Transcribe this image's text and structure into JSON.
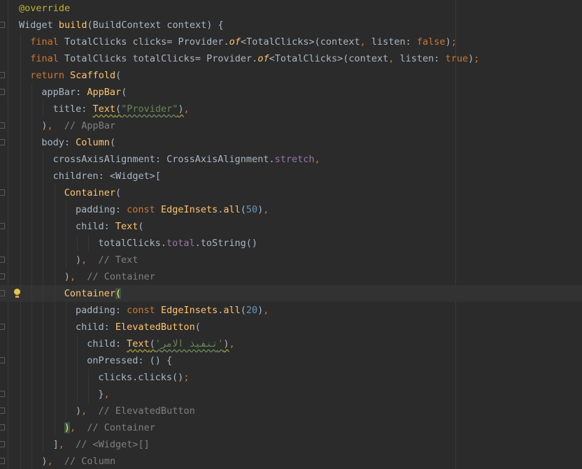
{
  "editor": {
    "lines": [
      {
        "indent": 0,
        "fold": false,
        "tokens": [
          {
            "t": "@override",
            "c": "ann"
          }
        ]
      },
      {
        "indent": 0,
        "fold": true,
        "tokens": [
          {
            "t": "Widget ",
            "c": "def"
          },
          {
            "t": "build",
            "c": "fn"
          },
          {
            "t": "(BuildContext context) {",
            "c": "def"
          }
        ]
      },
      {
        "indent": 1,
        "fold": false,
        "tokens": [
          {
            "t": "final ",
            "c": "kw"
          },
          {
            "t": "TotalClicks clicks= Provider.",
            "c": "def"
          },
          {
            "t": "of",
            "c": "ital"
          },
          {
            "t": "<TotalClicks>(context",
            "c": "def"
          },
          {
            "t": ", ",
            "c": "kw"
          },
          {
            "t": "listen: ",
            "c": "def"
          },
          {
            "t": "false",
            "c": "kw"
          },
          {
            "t": ")",
            "c": "def"
          },
          {
            "t": ";",
            "c": "kw"
          }
        ]
      },
      {
        "indent": 1,
        "fold": false,
        "tokens": [
          {
            "t": "final ",
            "c": "kw"
          },
          {
            "t": "TotalClicks totalClicks= Provider.",
            "c": "def"
          },
          {
            "t": "of",
            "c": "ital"
          },
          {
            "t": "<TotalClicks>(context",
            "c": "def"
          },
          {
            "t": ", ",
            "c": "kw"
          },
          {
            "t": "listen: ",
            "c": "def"
          },
          {
            "t": "true",
            "c": "kw"
          },
          {
            "t": ")",
            "c": "def"
          },
          {
            "t": ";",
            "c": "kw"
          }
        ]
      },
      {
        "indent": 1,
        "fold": true,
        "tokens": [
          {
            "t": "return ",
            "c": "kw"
          },
          {
            "t": "Scaffold",
            "c": "fn"
          },
          {
            "t": "(",
            "c": "def"
          }
        ]
      },
      {
        "indent": 2,
        "fold": true,
        "tokens": [
          {
            "t": "appBar: ",
            "c": "def"
          },
          {
            "t": "AppBar",
            "c": "fn"
          },
          {
            "t": "(",
            "c": "def"
          }
        ]
      },
      {
        "indent": 3,
        "fold": false,
        "tokens": [
          {
            "t": "title: ",
            "c": "def"
          },
          {
            "t": "Text",
            "c": "fn squig-y"
          },
          {
            "t": "(",
            "c": "def squig-y"
          },
          {
            "t": "\"Provider\"",
            "c": "str squig"
          },
          {
            "t": ")",
            "c": "def squig-y"
          },
          {
            "t": ",",
            "c": "kw"
          }
        ]
      },
      {
        "indent": 2,
        "fold": true,
        "tokens": [
          {
            "t": ")",
            "c": "def"
          },
          {
            "t": ",  ",
            "c": "kw"
          },
          {
            "t": "// AppBar",
            "c": "cmt"
          }
        ]
      },
      {
        "indent": 2,
        "fold": true,
        "tokens": [
          {
            "t": "body: ",
            "c": "def"
          },
          {
            "t": "Column",
            "c": "fn"
          },
          {
            "t": "(",
            "c": "def"
          }
        ]
      },
      {
        "indent": 3,
        "fold": false,
        "tokens": [
          {
            "t": "crossAxisAlignment: CrossAxisAlignment.",
            "c": "def"
          },
          {
            "t": "stretch",
            "c": "prop"
          },
          {
            "t": ",",
            "c": "kw"
          }
        ]
      },
      {
        "indent": 3,
        "fold": false,
        "tokens": [
          {
            "t": "children: <Widget>[",
            "c": "def"
          }
        ]
      },
      {
        "indent": 4,
        "fold": true,
        "tokens": [
          {
            "t": "Container",
            "c": "fn"
          },
          {
            "t": "(",
            "c": "def"
          }
        ]
      },
      {
        "indent": 5,
        "fold": false,
        "tokens": [
          {
            "t": "padding: ",
            "c": "def"
          },
          {
            "t": "const ",
            "c": "kw"
          },
          {
            "t": "EdgeInsets",
            "c": "fn"
          },
          {
            "t": ".",
            "c": "def"
          },
          {
            "t": "all",
            "c": "fn"
          },
          {
            "t": "(",
            "c": "def"
          },
          {
            "t": "50",
            "c": "num"
          },
          {
            "t": ")",
            "c": "def"
          },
          {
            "t": ",",
            "c": "kw"
          }
        ]
      },
      {
        "indent": 5,
        "fold": true,
        "tokens": [
          {
            "t": "child: ",
            "c": "def"
          },
          {
            "t": "Text",
            "c": "fn"
          },
          {
            "t": "(",
            "c": "def"
          }
        ]
      },
      {
        "indent": 7,
        "fold": false,
        "tokens": [
          {
            "t": "totalClicks.",
            "c": "def"
          },
          {
            "t": "total",
            "c": "prop"
          },
          {
            "t": ".toString()",
            "c": "def"
          }
        ]
      },
      {
        "indent": 5,
        "fold": true,
        "tokens": [
          {
            "t": ")",
            "c": "def"
          },
          {
            "t": ",  ",
            "c": "kw"
          },
          {
            "t": "// Text",
            "c": "cmt"
          }
        ]
      },
      {
        "indent": 4,
        "fold": true,
        "tokens": [
          {
            "t": ")",
            "c": "def"
          },
          {
            "t": ",  ",
            "c": "kw"
          },
          {
            "t": "// Container",
            "c": "cmt"
          }
        ]
      },
      {
        "indent": 4,
        "fold": true,
        "current": true,
        "bulb": true,
        "tokens": [
          {
            "t": "Container",
            "c": "fn"
          },
          {
            "t": "(",
            "c": "bracket-hl"
          }
        ]
      },
      {
        "indent": 5,
        "fold": false,
        "tokens": [
          {
            "t": "padding: ",
            "c": "def"
          },
          {
            "t": "const ",
            "c": "kw"
          },
          {
            "t": "EdgeInsets",
            "c": "fn"
          },
          {
            "t": ".",
            "c": "def"
          },
          {
            "t": "all",
            "c": "fn"
          },
          {
            "t": "(",
            "c": "def"
          },
          {
            "t": "20",
            "c": "num"
          },
          {
            "t": ")",
            "c": "def"
          },
          {
            "t": ",",
            "c": "kw"
          }
        ]
      },
      {
        "indent": 5,
        "fold": true,
        "tokens": [
          {
            "t": "child: ",
            "c": "def"
          },
          {
            "t": "ElevatedButton",
            "c": "fn"
          },
          {
            "t": "(",
            "c": "def"
          }
        ]
      },
      {
        "indent": 6,
        "fold": false,
        "tokens": [
          {
            "t": "child: ",
            "c": "def"
          },
          {
            "t": "Text",
            "c": "fn squig-y"
          },
          {
            "t": "(",
            "c": "def squig-y"
          },
          {
            "t": "'تنفيذ الامر'",
            "c": "str squig"
          },
          {
            "t": ")",
            "c": "def squig-y"
          },
          {
            "t": ",",
            "c": "kw"
          }
        ]
      },
      {
        "indent": 6,
        "fold": true,
        "tokens": [
          {
            "t": "onPressed: () {",
            "c": "def"
          }
        ]
      },
      {
        "indent": 7,
        "fold": false,
        "tokens": [
          {
            "t": "clicks.clicks()",
            "c": "def"
          },
          {
            "t": ";",
            "c": "kw"
          }
        ]
      },
      {
        "indent": 7,
        "fold": true,
        "tokens": [
          {
            "t": "}",
            "c": "def"
          },
          {
            "t": ",",
            "c": "kw"
          }
        ]
      },
      {
        "indent": 5,
        "fold": true,
        "tokens": [
          {
            "t": ")",
            "c": "def"
          },
          {
            "t": ",  ",
            "c": "kw"
          },
          {
            "t": "// ElevatedButton",
            "c": "cmt"
          }
        ]
      },
      {
        "indent": 4,
        "fold": true,
        "tokens": [
          {
            "t": ")",
            "c": "bracket-hl"
          },
          {
            "t": ",  ",
            "c": "kw"
          },
          {
            "t": "// Container",
            "c": "cmt"
          }
        ]
      },
      {
        "indent": 3,
        "fold": true,
        "tokens": [
          {
            "t": "]",
            "c": "def"
          },
          {
            "t": ",  ",
            "c": "kw"
          },
          {
            "t": "// <Widget>[]",
            "c": "cmt"
          }
        ]
      },
      {
        "indent": 2,
        "fold": true,
        "tokens": [
          {
            "t": ")",
            "c": "def"
          },
          {
            "t": ",  ",
            "c": "kw"
          },
          {
            "t": "// Column",
            "c": "cmt"
          }
        ]
      }
    ]
  }
}
